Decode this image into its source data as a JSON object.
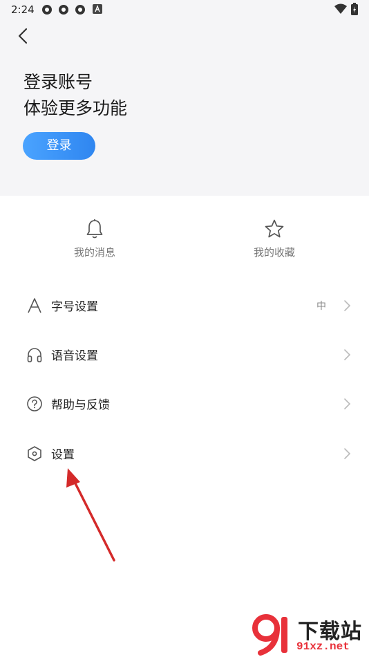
{
  "status_bar": {
    "time": "2:24"
  },
  "header": {
    "title_line1": "登录账号",
    "title_line2": "体验更多功能",
    "login_label": "登录",
    "accent": "#2f86f0",
    "background": "#f5f5f7"
  },
  "quick_actions": [
    {
      "label": "我的消息",
      "icon": "bell-icon"
    },
    {
      "label": "我的收藏",
      "icon": "star-icon"
    }
  ],
  "menu": [
    {
      "label": "字号设置",
      "value": "中",
      "icon": "font-icon"
    },
    {
      "label": "语音设置",
      "value": "",
      "icon": "headphones-icon"
    },
    {
      "label": "帮助与反馈",
      "value": "",
      "icon": "help-icon"
    },
    {
      "label": "设置",
      "value": "",
      "icon": "settings-hex-icon"
    }
  ],
  "watermark": {
    "title": "下载站",
    "url": "91xz.net",
    "color": "#e8313a"
  }
}
